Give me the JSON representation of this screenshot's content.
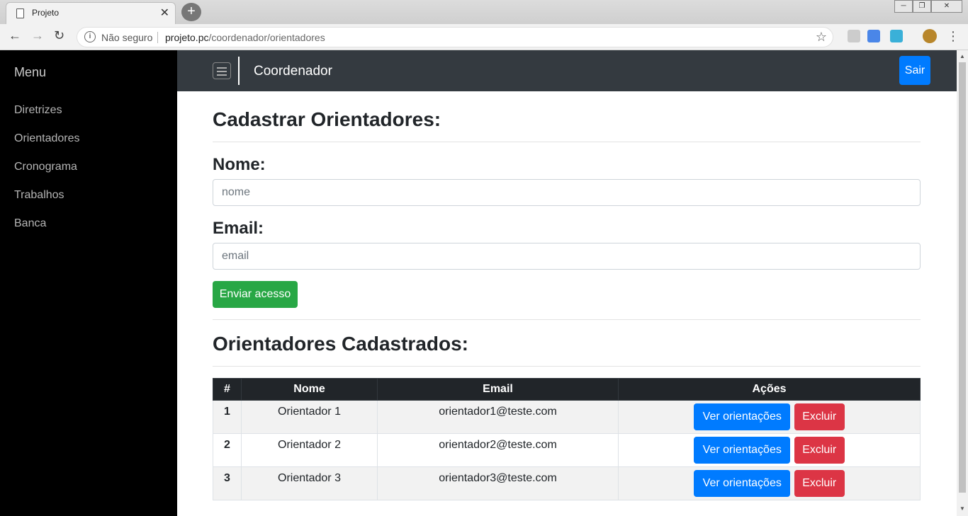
{
  "browser": {
    "tab_title": "Projeto",
    "tab_close": "✕",
    "new_tab": "+",
    "security_label": "Não seguro",
    "url_host": "projeto.pc",
    "url_path": "/coordenador/orientadores"
  },
  "sidebar": {
    "title": "Menu",
    "items": [
      {
        "label": "Diretrizes"
      },
      {
        "label": "Orientadores"
      },
      {
        "label": "Cronograma"
      },
      {
        "label": "Trabalhos"
      },
      {
        "label": "Banca"
      }
    ]
  },
  "navbar": {
    "brand": "Coordenador",
    "logout_label": "Sair"
  },
  "form": {
    "title": "Cadastrar Orientadores:",
    "name_label": "Nome:",
    "name_placeholder": "nome",
    "email_label": "Email:",
    "email_placeholder": "email",
    "submit_label": "Enviar acesso"
  },
  "list": {
    "title": "Orientadores Cadastrados:",
    "columns": [
      "#",
      "Nome",
      "Email",
      "Ações"
    ],
    "rows": [
      {
        "num": "1",
        "name": "Orientador 1",
        "email": "orientador1@teste.com"
      },
      {
        "num": "2",
        "name": "Orientador 2",
        "email": "orientador2@teste.com"
      },
      {
        "num": "3",
        "name": "Orientador 3",
        "email": "orientador3@teste.com"
      }
    ],
    "view_label": "Ver orientações",
    "delete_label": "Excluir"
  },
  "colors": {
    "primary": "#007bff",
    "success": "#28a745",
    "danger": "#dc3545",
    "navbar": "#343a40",
    "sidebar": "#000000"
  }
}
